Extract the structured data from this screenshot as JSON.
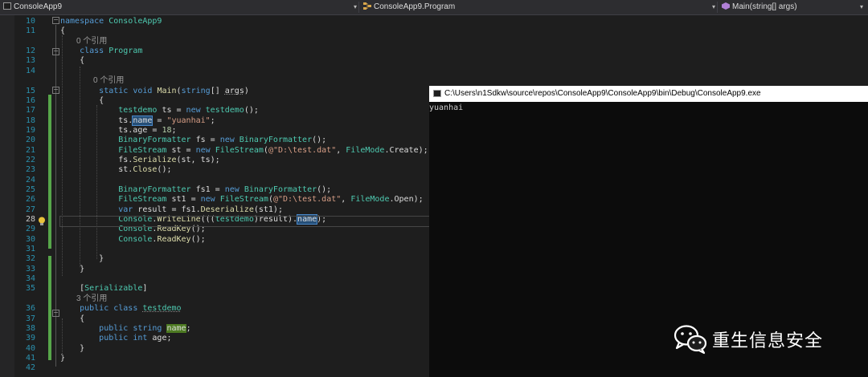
{
  "navbar": {
    "project": "ConsoleApp9",
    "class_scope": "ConsoleApp9.Program",
    "member": "Main(string[] args)"
  },
  "editor": {
    "lines": [
      {
        "n": "10",
        "html": "<span class=\"kw\">namespace</span> <span class=\"ty\">ConsoleApp9</span>"
      },
      {
        "n": "11",
        "html": "{"
      },
      {
        "lens": "0 个引用"
      },
      {
        "n": "12",
        "html": "    <span class=\"kw\">class</span> <span class=\"ty\">Program</span>"
      },
      {
        "n": "13",
        "html": "    {"
      },
      {
        "n": "14",
        "html": ""
      },
      {
        "lens": "0 个引用"
      },
      {
        "n": "15",
        "html": "        <span class=\"kw\">static</span> <span class=\"kw\">void</span> <span class=\"mt\">Main</span>(<span class=\"kw\">string</span>[] <span class=\"ul\">args</span>)"
      },
      {
        "n": "16",
        "html": "        {"
      },
      {
        "n": "17",
        "html": "            <span class=\"ty\">testdemo</span> ts = <span class=\"kw\">new</span> <span class=\"ty\">testdemo</span>();"
      },
      {
        "n": "18",
        "html": "            ts.<span class=\"hl\">name</span> = <span class=\"st\">\"yuanhai\"</span>;"
      },
      {
        "n": "19",
        "html": "            ts.age = <span class=\"nm\">18</span>;"
      },
      {
        "n": "20",
        "html": "            <span class=\"ty\">BinaryFormatter</span> fs = <span class=\"kw\">new</span> <span class=\"ty\">BinaryFormatter</span>();"
      },
      {
        "n": "21",
        "html": "            <span class=\"ty\">FileStream</span> st = <span class=\"kw\">new</span> <span class=\"ty\">FileStream</span>(<span class=\"st\">@\"D:\\test.dat\"</span>, <span class=\"ty\">FileMode</span>.Create);"
      },
      {
        "n": "22",
        "html": "            fs.<span class=\"mt\">Serialize</span>(st, ts);"
      },
      {
        "n": "23",
        "html": "            st.<span class=\"mt\">Close</span>();"
      },
      {
        "n": "24",
        "html": ""
      },
      {
        "n": "25",
        "html": "            <span class=\"ty\">BinaryFormatter</span> fs1 = <span class=\"kw\">new</span> <span class=\"ty\">BinaryFormatter</span>();"
      },
      {
        "n": "26",
        "html": "            <span class=\"ty\">FileStream</span> st1 = <span class=\"kw\">new</span> <span class=\"ty\">FileStream</span>(<span class=\"st\">@\"D:\\test.dat\"</span>, <span class=\"ty\">FileMode</span>.Open);"
      },
      {
        "n": "27",
        "html": "            <span class=\"kw\">var</span> result = fs1.<span class=\"mt\">Deserialize</span>(st1);"
      },
      {
        "n": "28",
        "html": "            <span class=\"ty\">Console</span>.<span class=\"mt\">WriteLine</span>(((<span class=\"ty\">testdemo</span>)result).<span class=\"hl\">name</span>);"
      },
      {
        "n": "29",
        "html": "            <span class=\"ty\">Console</span>.<span class=\"mt\">ReadKey</span>();"
      },
      {
        "n": "30",
        "html": "            <span class=\"ty\">Console</span>.<span class=\"mt\">ReadKey</span>();"
      },
      {
        "n": "31",
        "html": ""
      },
      {
        "n": "32",
        "html": "        }"
      },
      {
        "n": "33",
        "html": "    }"
      },
      {
        "n": "34",
        "html": ""
      },
      {
        "n": "35",
        "html": "    [<span class=\"ty\">Serializable</span>]"
      },
      {
        "lens": "3 个引用"
      },
      {
        "n": "36",
        "html": "    <span class=\"kw\">public</span> <span class=\"kw\">class</span> <span class=\"ty ul\">testdemo</span>"
      },
      {
        "n": "37",
        "html": "    {"
      },
      {
        "n": "38",
        "html": "        <span class=\"kw\">public</span> <span class=\"kw\">string</span> <span class=\"hl2\">name</span>;"
      },
      {
        "n": "39",
        "html": "        <span class=\"kw\">public</span> <span class=\"kw\">int</span> age;"
      },
      {
        "n": "40",
        "html": "    }"
      },
      {
        "n": "41",
        "html": "}"
      },
      {
        "n": "42",
        "html": ""
      }
    ]
  },
  "console": {
    "title": "C:\\Users\\n1Sdkw\\source\\repos\\ConsoleApp9\\ConsoleApp9\\bin\\Debug\\ConsoleApp9.exe",
    "output": "yuanhai"
  },
  "watermark": {
    "text": "重生信息安全",
    "icon": "wechat-icon"
  },
  "colors": {
    "editor_bg": "#1e1e1e",
    "keyword": "#569cd6",
    "type": "#4ec9b0",
    "string": "#d69d85",
    "line_number": "#2b91af",
    "change_bar": "#57a64a",
    "console_bg": "#0c0c0c"
  }
}
